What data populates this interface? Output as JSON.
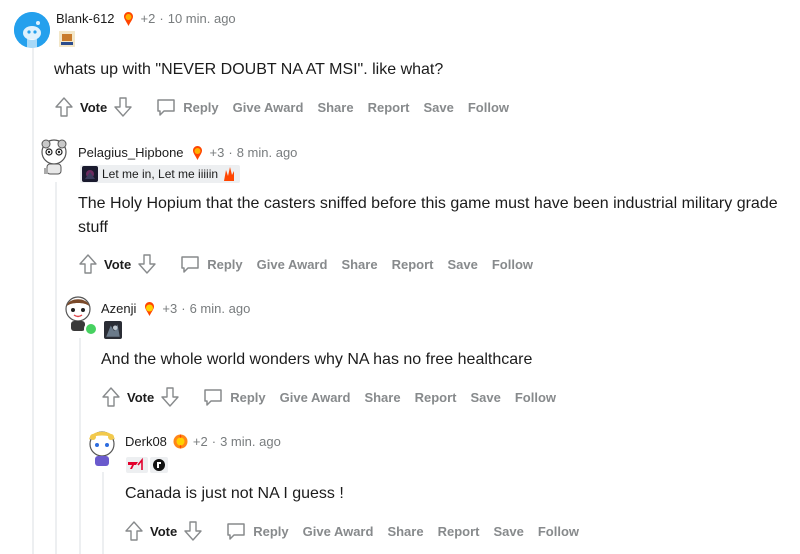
{
  "comments": [
    {
      "username": "Blank-612",
      "karma": "+2",
      "time": "10 min. ago",
      "flair_text": "",
      "body": "whats up with \"NEVER DOUBT NA AT MSI\". like what?",
      "actions": {
        "vote": "Vote",
        "reply": "Reply",
        "give_award": "Give Award",
        "share": "Share",
        "report": "Report",
        "save": "Save",
        "follow": "Follow"
      }
    },
    {
      "username": "Pelagius_Hipbone",
      "karma": "+3",
      "time": "8 min. ago",
      "flair_text": "Let me in, Let me iiiiin",
      "body": "The Holy Hopium that the casters sniffed before this game must have been industrial military grade stuff",
      "actions": {
        "vote": "Vote",
        "reply": "Reply",
        "give_award": "Give Award",
        "share": "Share",
        "report": "Report",
        "save": "Save",
        "follow": "Follow"
      }
    },
    {
      "username": "Azenji",
      "karma": "+3",
      "time": "6 min. ago",
      "flair_text": "",
      "body": "And the whole world wonders why NA has no free healthcare",
      "actions": {
        "vote": "Vote",
        "reply": "Reply",
        "give_award": "Give Award",
        "share": "Share",
        "report": "Report",
        "save": "Save",
        "follow": "Follow"
      }
    },
    {
      "username": "Derk08",
      "karma": "+2",
      "time": "3 min. ago",
      "flair_text": "",
      "body": "Canada is just not NA I guess !",
      "actions": {
        "vote": "Vote",
        "reply": "Reply",
        "give_award": "Give Award",
        "share": "Share",
        "report": "Report",
        "save": "Save",
        "follow": "Follow"
      }
    }
  ],
  "separator": "·",
  "colors": {
    "meta": "#787c7e",
    "action": "#878a8c",
    "thread_line": "#edeff1",
    "online": "#46d160",
    "award": "#ff4500"
  }
}
